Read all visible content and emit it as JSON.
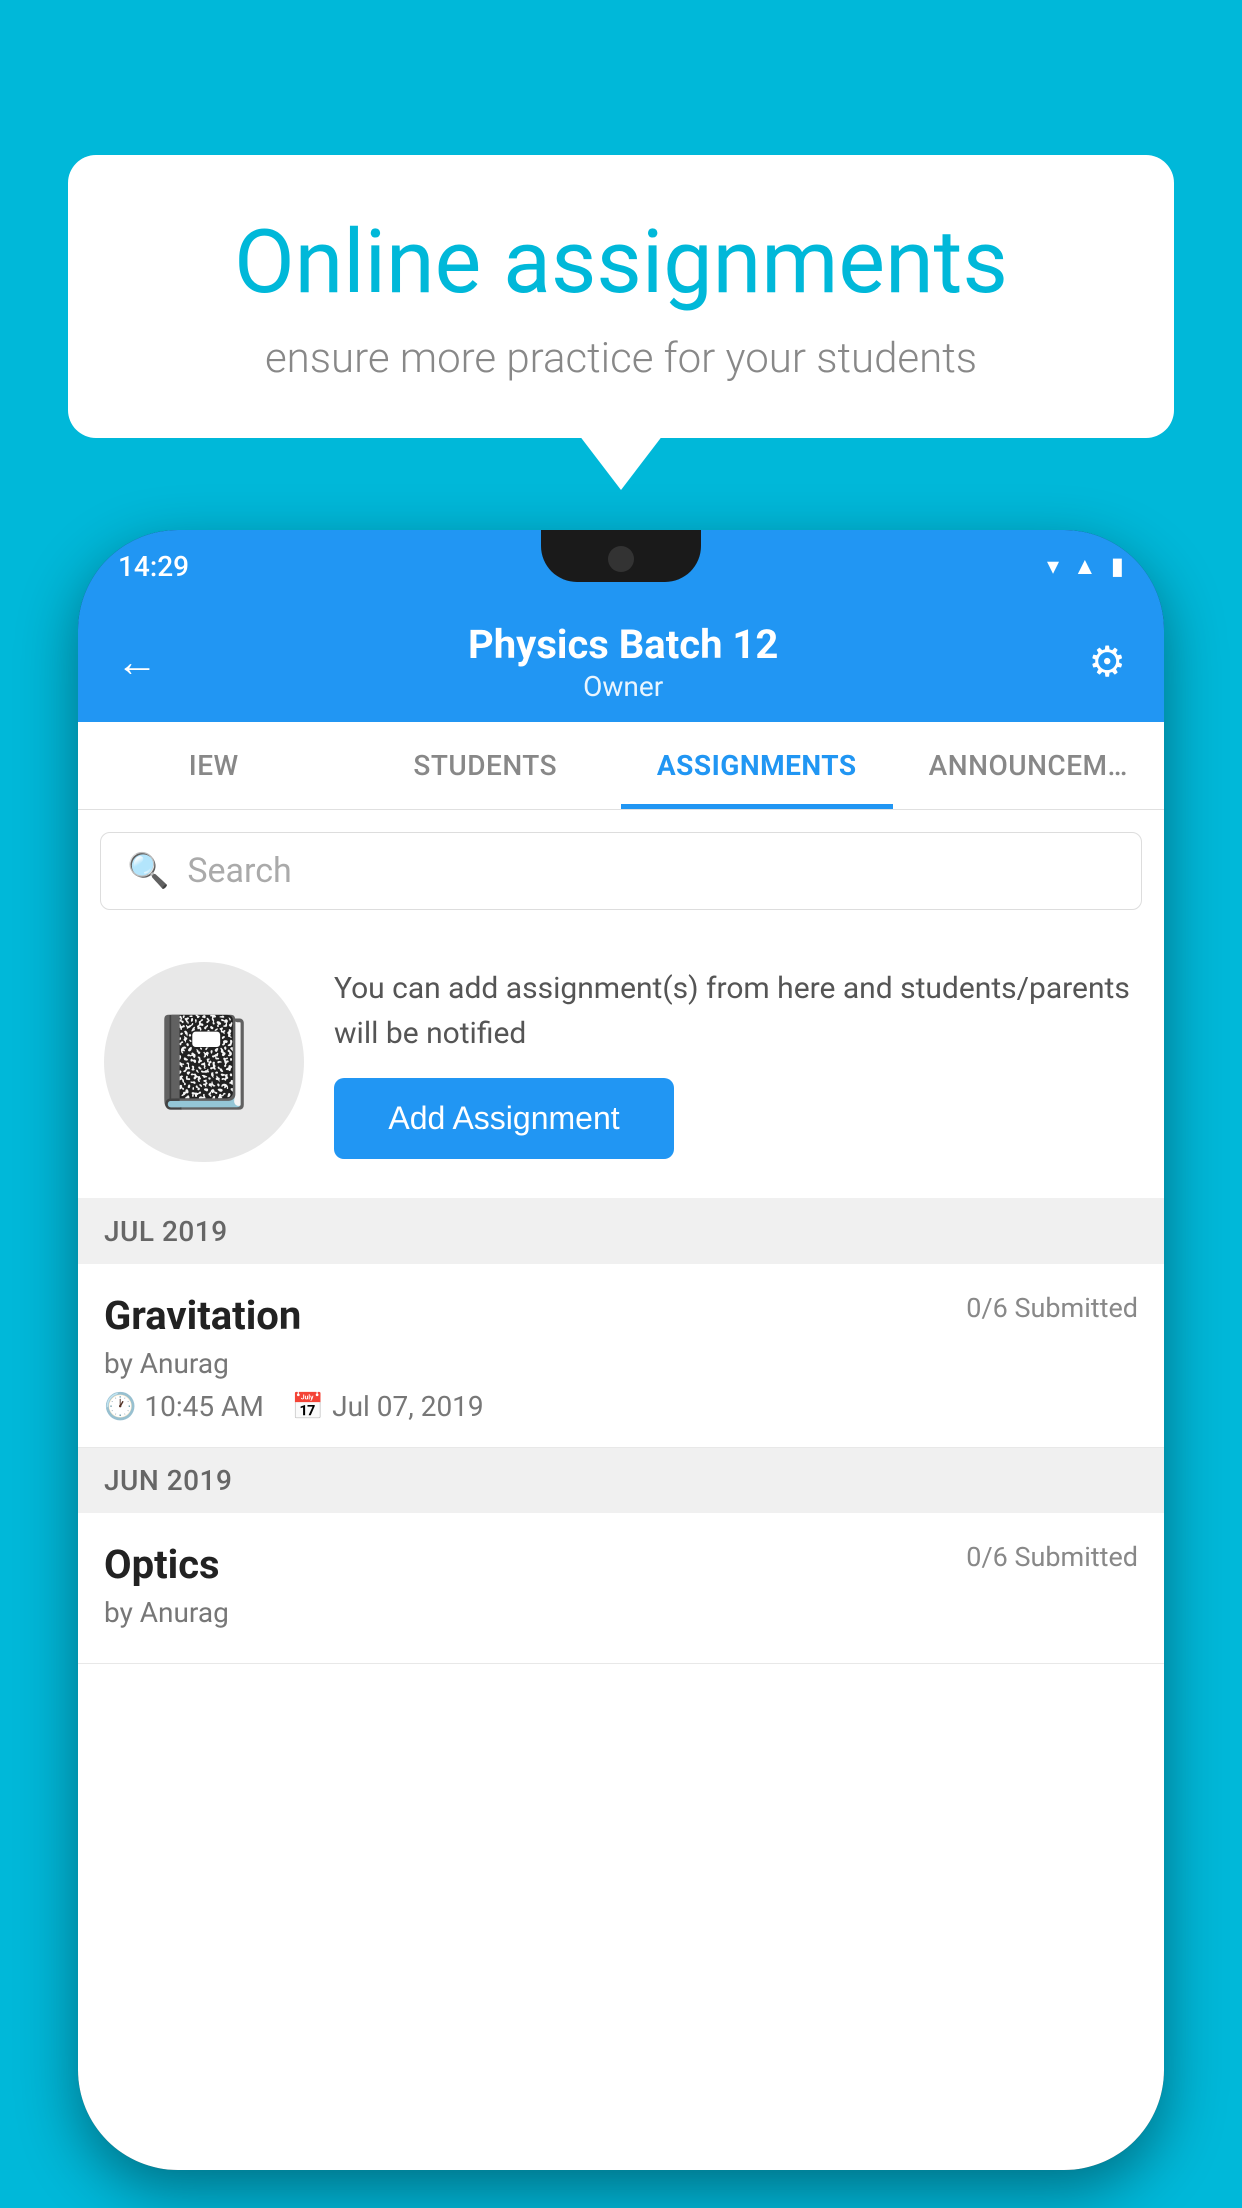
{
  "background_color": "#00B8D9",
  "promo": {
    "title": "Online assignments",
    "subtitle": "ensure more practice for your students"
  },
  "status_bar": {
    "time": "14:29",
    "icons": [
      "wifi",
      "signal",
      "battery"
    ]
  },
  "header": {
    "title": "Physics Batch 12",
    "subtitle": "Owner",
    "back_label": "←",
    "settings_label": "⚙"
  },
  "tabs": [
    {
      "label": "IEW",
      "active": false
    },
    {
      "label": "STUDENTS",
      "active": false
    },
    {
      "label": "ASSIGNMENTS",
      "active": true
    },
    {
      "label": "ANNOUNCEM…",
      "active": false
    }
  ],
  "search": {
    "placeholder": "Search"
  },
  "assignment_promo": {
    "description": "You can add assignment(s) from here and students/parents will be notified",
    "add_button_label": "Add Assignment"
  },
  "sections": [
    {
      "label": "JUL 2019",
      "assignments": [
        {
          "name": "Gravitation",
          "submitted": "0/6 Submitted",
          "author": "by Anurag",
          "time": "10:45 AM",
          "date": "Jul 07, 2019"
        }
      ]
    },
    {
      "label": "JUN 2019",
      "assignments": [
        {
          "name": "Optics",
          "submitted": "0/6 Submitted",
          "author": "by Anurag",
          "time": "",
          "date": ""
        }
      ]
    }
  ]
}
